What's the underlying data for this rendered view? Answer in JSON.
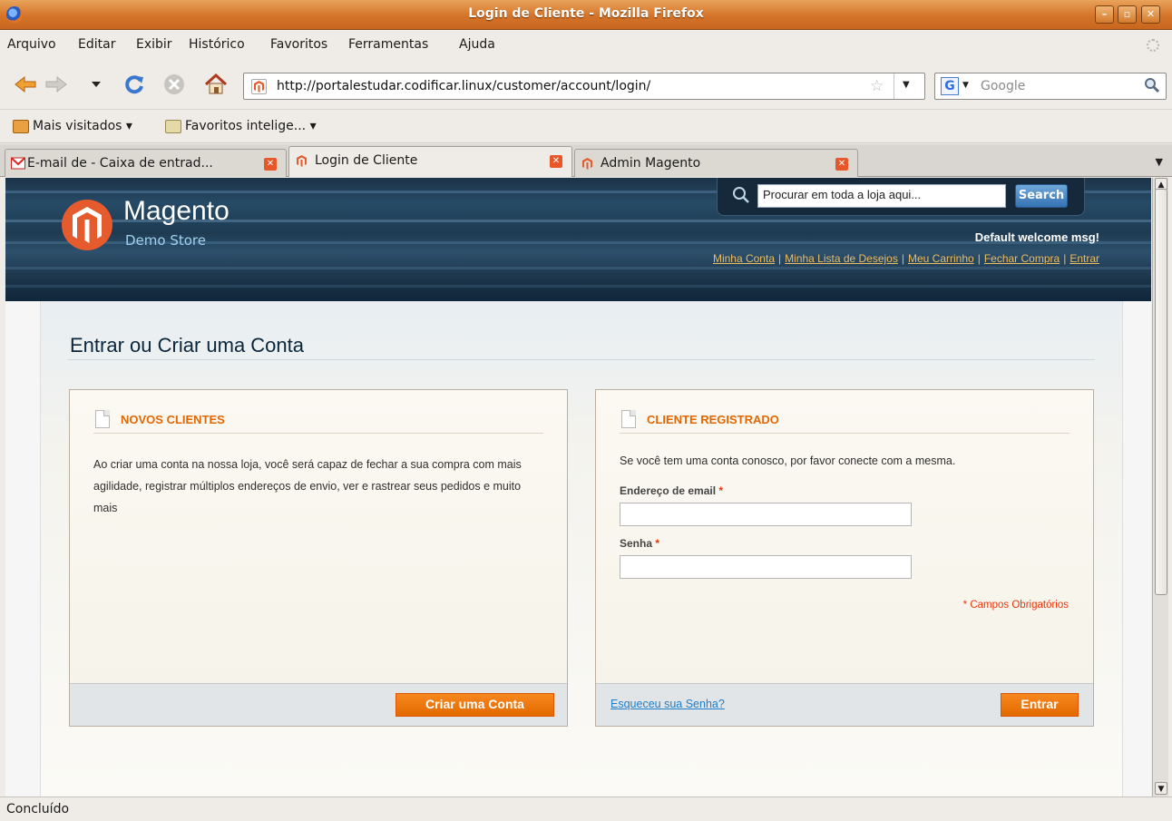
{
  "window": {
    "title": "Login de Cliente - Mozilla Firefox"
  },
  "menu": [
    "Arquivo",
    "Editar",
    "Exibir",
    "Histórico",
    "Favoritos",
    "Ferramentas",
    "Ajuda"
  ],
  "nav": {
    "url": "http://portalestudar.codificar.linux/customer/account/login/",
    "search_placeholder": "Google",
    "icons": [
      "back-icon",
      "forward-icon",
      "history-dropdown-icon",
      "reload-icon",
      "stop-icon",
      "home-icon"
    ]
  },
  "bookmarks": [
    {
      "label": "Mais visitados ▾",
      "icon": "most-visited-icon"
    },
    {
      "label": "Favoritos intelige... ▾",
      "icon": "smart-bookmarks-folder-icon"
    }
  ],
  "tabs": [
    {
      "label": "E-mail de  - Caixa de entrad...",
      "icon": "gmail-icon",
      "active": false
    },
    {
      "label": "Login de Cliente",
      "icon": "magento-icon",
      "active": true
    },
    {
      "label": "Admin Magento",
      "icon": "magento-icon",
      "active": false
    }
  ],
  "store": {
    "logo_name": "Magento",
    "logo_sub": "Demo Store",
    "search_value": "Procurar em toda a loja aqui...",
    "search_button": "Search",
    "welcome": "Default welcome msg!",
    "links": [
      "Minha Conta",
      "Minha Lista de Desejos",
      "Meu Carrinho",
      "Fechar Compra",
      "Entrar"
    ]
  },
  "page": {
    "title": "Entrar ou Criar uma Conta",
    "new_customers": {
      "heading": "NOVOS CLIENTES",
      "text": "Ao criar uma conta na nossa loja, você será capaz de fechar a sua compra com mais agilidade, registrar múltiplos endereços de envio, ver e rastrear seus pedidos e muito mais",
      "button": "Criar uma Conta"
    },
    "registered": {
      "heading": "CLIENTE REGISTRADO",
      "text": "Se você tem uma conta conosco, por favor conecte com a mesma.",
      "email_label": "Endereço de email",
      "password_label": "Senha",
      "required_marker": "*",
      "required_note": "* Campos Obrigatórios",
      "forgot_link": "Esqueceu sua Senha?",
      "button": "Entrar"
    }
  },
  "status": {
    "text": "Concluído"
  },
  "colors": {
    "accent_orange": "#e26703",
    "header_navy": "#1c3347",
    "link_gold": "#ebbc61",
    "required_red": "#eb340a"
  }
}
